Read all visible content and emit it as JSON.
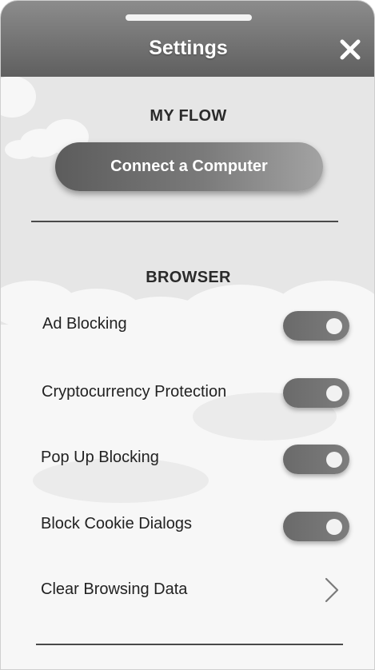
{
  "header": {
    "title": "Settings"
  },
  "my_flow": {
    "section_title": "MY FLOW",
    "connect_label": "Connect a Computer"
  },
  "browser": {
    "section_title": "BROWSER",
    "items": [
      {
        "label": "Ad Blocking",
        "toggle_on": true
      },
      {
        "label": "Cryptocurrency Protection",
        "toggle_on": true
      },
      {
        "label": "Pop Up Blocking",
        "toggle_on": true
      },
      {
        "label": "Block Cookie Dialogs",
        "toggle_on": true
      }
    ],
    "clear_label": "Clear Browsing Data"
  },
  "icons": {
    "close": "close-icon",
    "clear_chevron": "chevron-right-icon"
  },
  "colors": {
    "header": "#6f6f6f",
    "button": "#6e6e6e",
    "toggle_track": "#727272",
    "toggle_knob": "#f2f2f2"
  }
}
